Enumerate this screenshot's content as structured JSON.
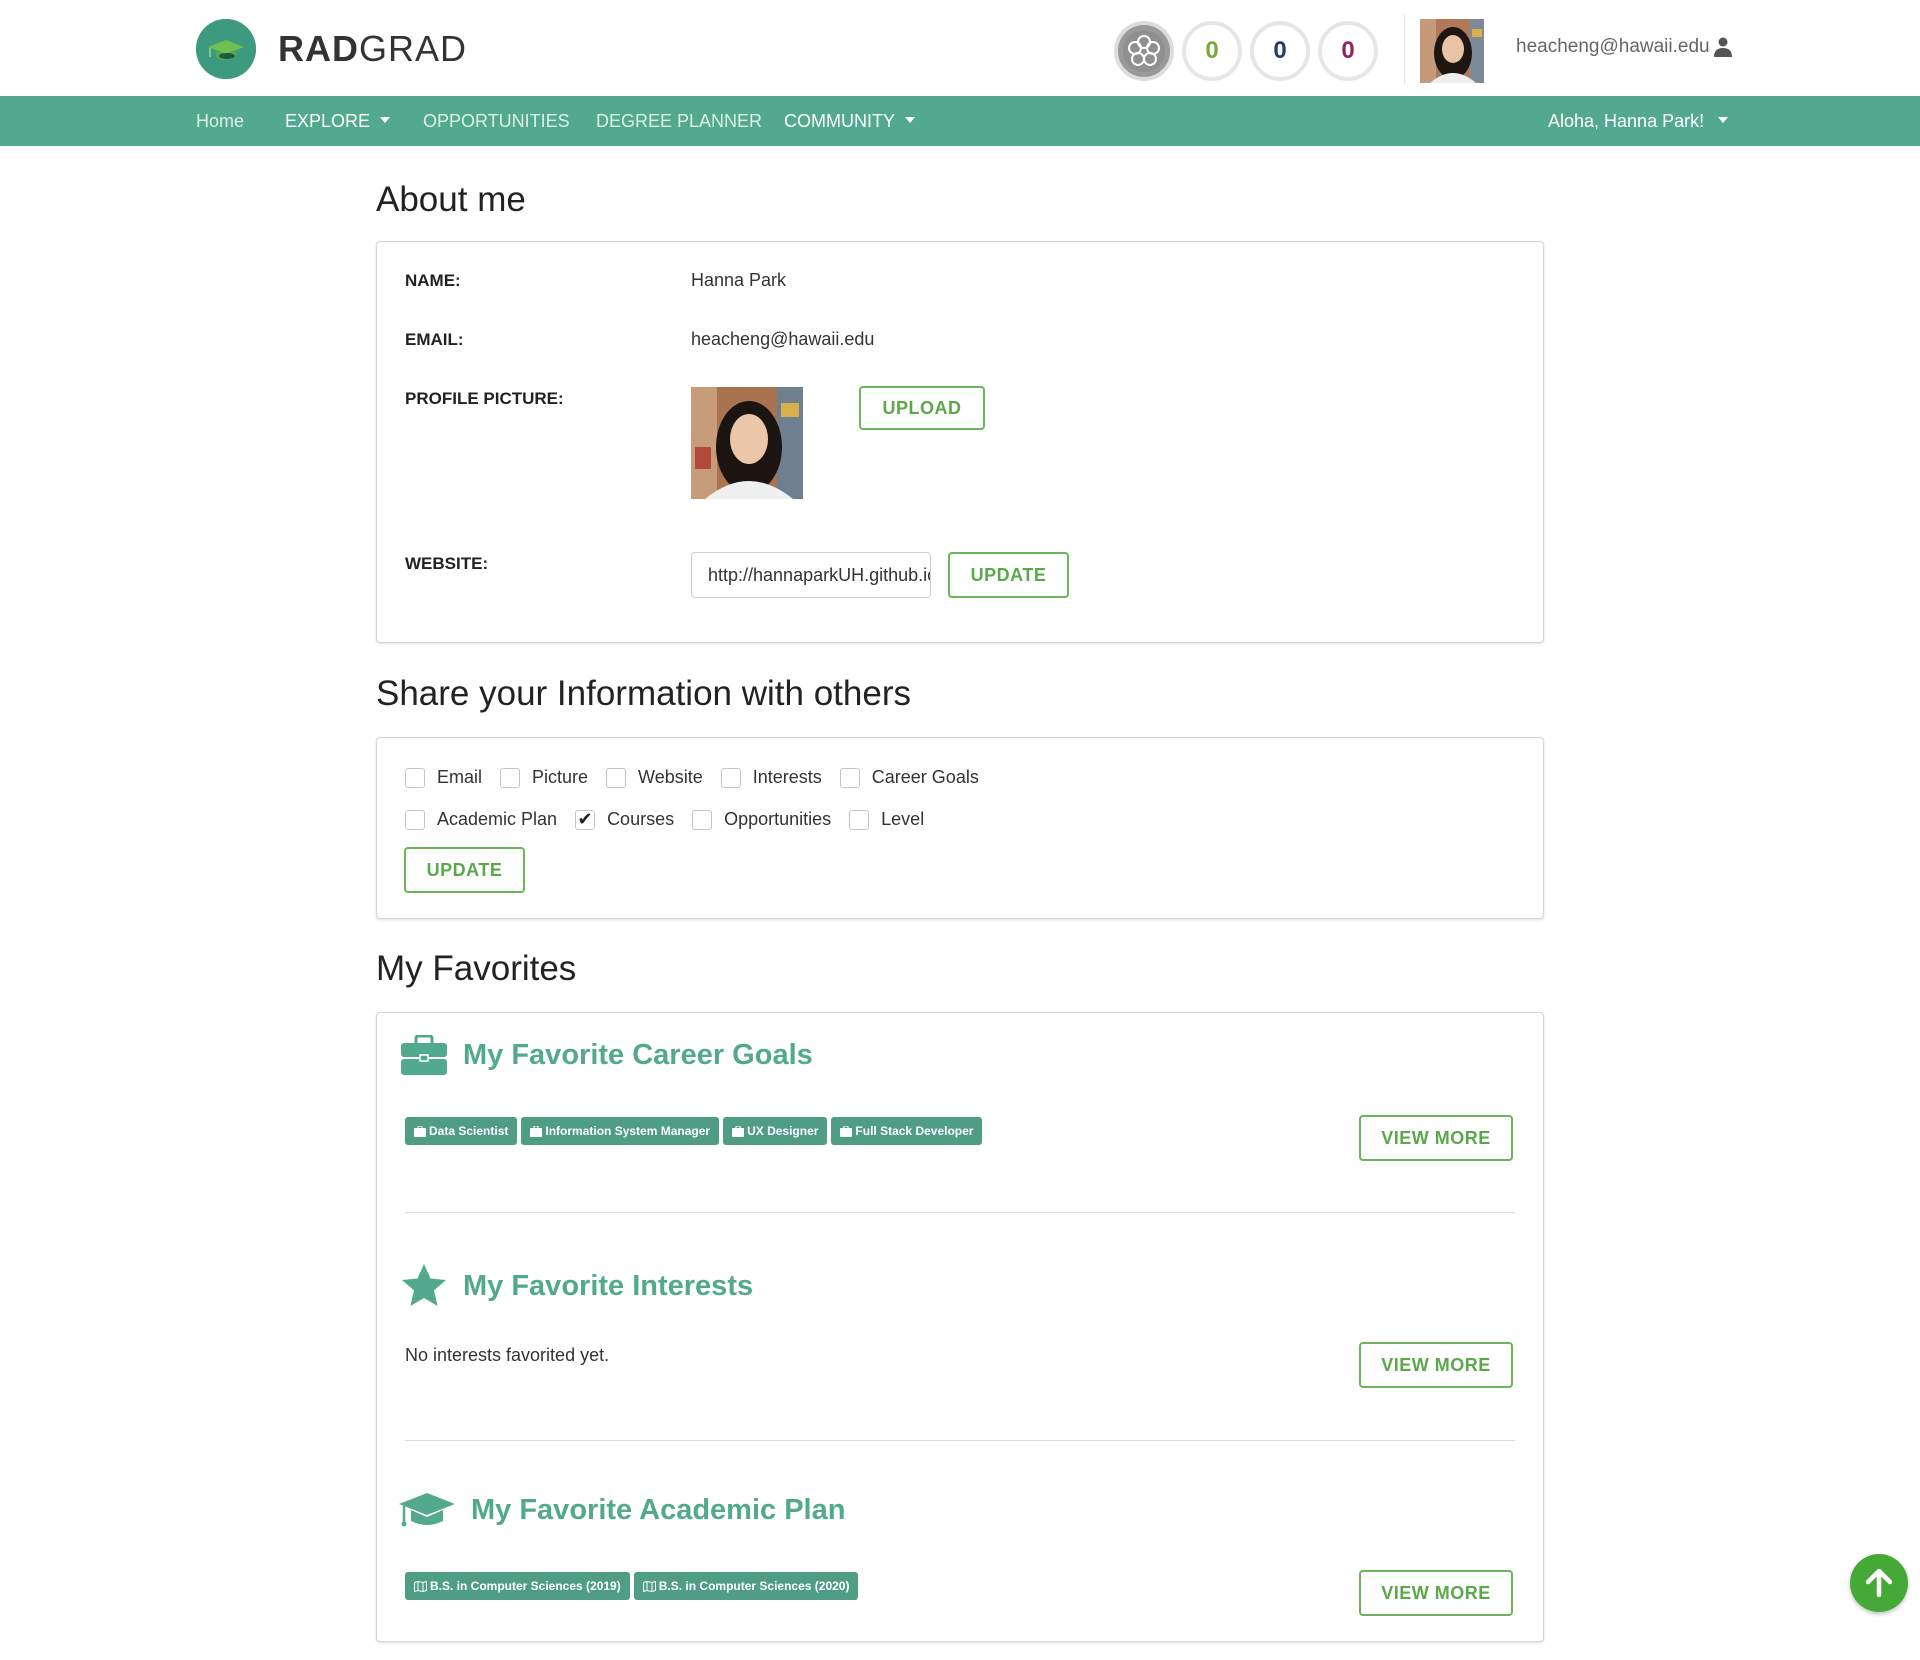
{
  "brand": {
    "name_bold": "RAD",
    "name_light": "GRAD",
    "accent": "#52a98e"
  },
  "header": {
    "stats": [
      {
        "value": "0",
        "color": "#7aa93b"
      },
      {
        "value": "0",
        "color": "#1f3a73"
      },
      {
        "value": "0",
        "color": "#8e2462"
      }
    ],
    "user_email": "heacheng@hawaii.edu",
    "user_icon": "user-icon"
  },
  "nav": {
    "home": "Home",
    "explore": "EXPLORE",
    "opportunities": "OPPORTUNITIES",
    "degree_planner": "DEGREE PLANNER",
    "community": "COMMUNITY",
    "greeting": "Aloha, Hanna Park!"
  },
  "about": {
    "title": "About me",
    "name_label": "NAME:",
    "name_value": "Hanna Park",
    "email_label": "EMAIL:",
    "email_value": "heacheng@hawaii.edu",
    "picture_label": "PROFILE PICTURE:",
    "upload_button": "UPLOAD",
    "website_label": "WEBSITE:",
    "website_value": "http://hannaparkUH.github.io",
    "update_button": "UPDATE"
  },
  "share": {
    "title": "Share your Information with others",
    "row1": [
      {
        "label": "Email",
        "checked": false
      },
      {
        "label": "Picture",
        "checked": false
      },
      {
        "label": "Website",
        "checked": false
      },
      {
        "label": "Interests",
        "checked": false
      },
      {
        "label": "Career Goals",
        "checked": false
      }
    ],
    "row2": [
      {
        "label": "Academic Plan",
        "checked": false
      },
      {
        "label": "Courses",
        "checked": true
      },
      {
        "label": "Opportunities",
        "checked": false
      },
      {
        "label": "Level",
        "checked": false
      }
    ],
    "check_mark": "✔",
    "update_button": "UPDATE"
  },
  "favorites": {
    "title": "My Favorites",
    "career": {
      "title": "My Favorite Career Goals",
      "icon": "briefcase-icon",
      "tags": [
        "Data Scientist",
        "Information System Manager",
        "UX Designer",
        "Full Stack Developer"
      ],
      "view_more": "VIEW MORE"
    },
    "interests": {
      "title": "My Favorite Interests",
      "icon": "star-icon",
      "empty_text": "No interests favorited yet.",
      "view_more": "VIEW MORE"
    },
    "plan": {
      "title": "My Favorite Academic Plan",
      "icon": "graduation-cap-icon",
      "tags": [
        "B.S. in Computer Sciences (2019)",
        "B.S. in Computer Sciences (2020)"
      ],
      "view_more": "VIEW MORE"
    }
  },
  "scroll_top_icon": "arrow-up-icon"
}
